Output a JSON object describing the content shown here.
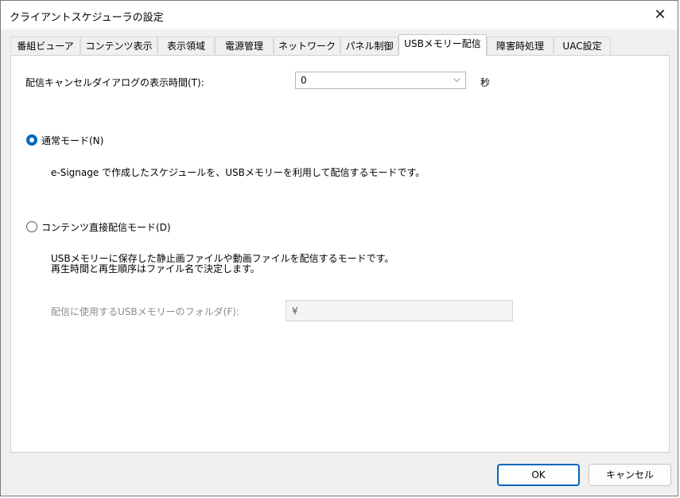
{
  "window": {
    "title": "クライアントスケジューラの設定",
    "close_glyph": "✕"
  },
  "tabs": [
    {
      "label": "番組ビューア"
    },
    {
      "label": "コンテンツ表示"
    },
    {
      "label": "表示領域"
    },
    {
      "label": "電源管理"
    },
    {
      "label": "ネットワーク"
    },
    {
      "label": "パネル制御"
    },
    {
      "label": "USBメモリー配信"
    },
    {
      "label": "障害時処理"
    },
    {
      "label": "UAC設定"
    }
  ],
  "active_tab": "USBメモリー配信",
  "dialog_time": {
    "label": "配信キャンセルダイアログの表示時間(T):",
    "value": "0",
    "unit": "秒"
  },
  "normal_mode": {
    "label": "通常モード(N)",
    "selected": true,
    "description": "e-Signage で作成したスケジュールを、USBメモリーを利用して配信するモードです。"
  },
  "direct_mode": {
    "label": "コンテンツ直接配信モード(D)",
    "selected": false,
    "description_line1": "USBメモリーに保存した静止画ファイルや動画ファイルを配信するモードです。",
    "description_line2": "再生時間と再生順序はファイル名で決定します。",
    "folder_label": "配信に使用するUSBメモリーのフォルダ(F):",
    "folder_value": "¥"
  },
  "buttons": {
    "ok": "OK",
    "cancel": "キャンセル"
  },
  "colors": {
    "accent": "#0067c0",
    "panel": "#ffffff",
    "background": "#f0f0f0"
  }
}
